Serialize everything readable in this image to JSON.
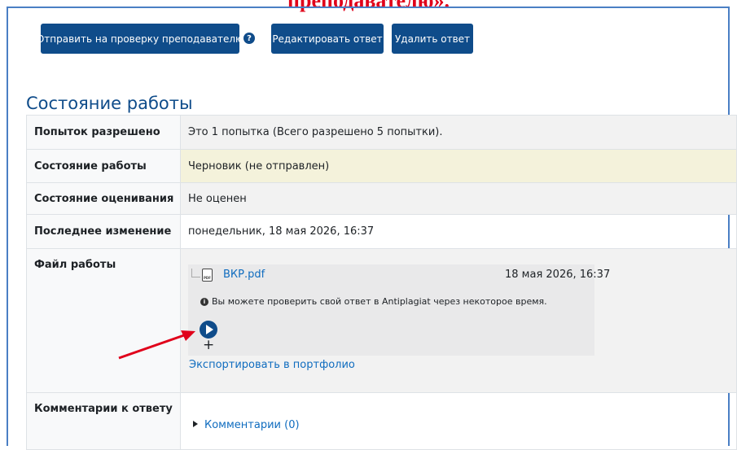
{
  "caption": "преподавателю».",
  "actions": {
    "submit_label": "Отправить на проверку преподавателю",
    "help_glyph": "?",
    "edit_label": "Редактировать ответ",
    "delete_label": "Удалить ответ"
  },
  "section_title": "Состояние работы",
  "status_table": {
    "attempts_label": "Попыток разрешено",
    "attempts_value": "Это 1 попытка (Всего разрешено 5 попытки).",
    "submission_label": "Состояние работы",
    "submission_value": "Черновик (не отправлен)",
    "grading_label": "Состояние оценивания",
    "grading_value": "Не оценен",
    "modified_label": "Последнее изменение",
    "modified_value": "понедельник, 18 мая 2026, 16:37",
    "files_label": "Файл работы",
    "comments_label": "Комментарии к ответу"
  },
  "file": {
    "name": "ВКР.pdf",
    "date": "18 мая 2026, 16:37",
    "icon": "pdf-file-icon",
    "icon_tag": "PDF",
    "plagiarism_note": "Вы можете проверить свой ответ в Antiplagiat через некоторое время.",
    "info_glyph": "i",
    "plus_glyph": "+",
    "export_link": "Экспортировать в портфолио"
  },
  "comments": {
    "toggle_label": "Комментарии (0)"
  },
  "colors": {
    "primary": "#0f4c8a",
    "link": "#0f6cbf",
    "draft_highlight": "#f4f2db",
    "annotation_red": "#e0001a"
  }
}
